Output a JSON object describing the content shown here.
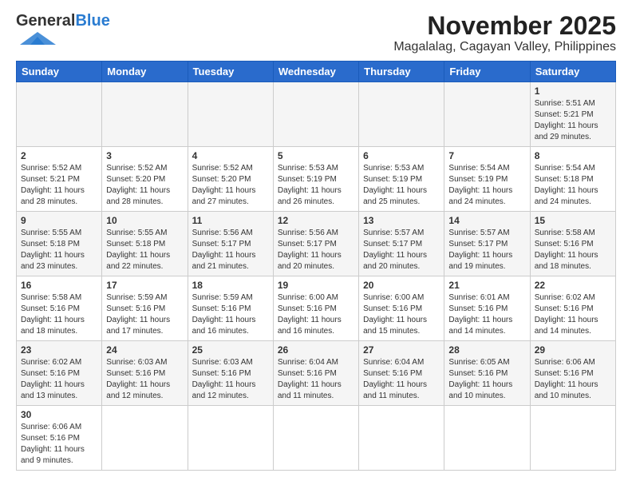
{
  "header": {
    "logo_general": "General",
    "logo_blue": "Blue",
    "month_title": "November 2025",
    "location": "Magalalag, Cagayan Valley, Philippines"
  },
  "days_of_week": [
    "Sunday",
    "Monday",
    "Tuesday",
    "Wednesday",
    "Thursday",
    "Friday",
    "Saturday"
  ],
  "weeks": [
    [
      {
        "day": "",
        "info": ""
      },
      {
        "day": "",
        "info": ""
      },
      {
        "day": "",
        "info": ""
      },
      {
        "day": "",
        "info": ""
      },
      {
        "day": "",
        "info": ""
      },
      {
        "day": "",
        "info": ""
      },
      {
        "day": "1",
        "info": "Sunrise: 5:51 AM\nSunset: 5:21 PM\nDaylight: 11 hours\nand 29 minutes."
      }
    ],
    [
      {
        "day": "2",
        "info": "Sunrise: 5:52 AM\nSunset: 5:21 PM\nDaylight: 11 hours\nand 28 minutes."
      },
      {
        "day": "3",
        "info": "Sunrise: 5:52 AM\nSunset: 5:20 PM\nDaylight: 11 hours\nand 28 minutes."
      },
      {
        "day": "4",
        "info": "Sunrise: 5:52 AM\nSunset: 5:20 PM\nDaylight: 11 hours\nand 27 minutes."
      },
      {
        "day": "5",
        "info": "Sunrise: 5:53 AM\nSunset: 5:19 PM\nDaylight: 11 hours\nand 26 minutes."
      },
      {
        "day": "6",
        "info": "Sunrise: 5:53 AM\nSunset: 5:19 PM\nDaylight: 11 hours\nand 25 minutes."
      },
      {
        "day": "7",
        "info": "Sunrise: 5:54 AM\nSunset: 5:19 PM\nDaylight: 11 hours\nand 24 minutes."
      },
      {
        "day": "8",
        "info": "Sunrise: 5:54 AM\nSunset: 5:18 PM\nDaylight: 11 hours\nand 24 minutes."
      }
    ],
    [
      {
        "day": "9",
        "info": "Sunrise: 5:55 AM\nSunset: 5:18 PM\nDaylight: 11 hours\nand 23 minutes."
      },
      {
        "day": "10",
        "info": "Sunrise: 5:55 AM\nSunset: 5:18 PM\nDaylight: 11 hours\nand 22 minutes."
      },
      {
        "day": "11",
        "info": "Sunrise: 5:56 AM\nSunset: 5:17 PM\nDaylight: 11 hours\nand 21 minutes."
      },
      {
        "day": "12",
        "info": "Sunrise: 5:56 AM\nSunset: 5:17 PM\nDaylight: 11 hours\nand 20 minutes."
      },
      {
        "day": "13",
        "info": "Sunrise: 5:57 AM\nSunset: 5:17 PM\nDaylight: 11 hours\nand 20 minutes."
      },
      {
        "day": "14",
        "info": "Sunrise: 5:57 AM\nSunset: 5:17 PM\nDaylight: 11 hours\nand 19 minutes."
      },
      {
        "day": "15",
        "info": "Sunrise: 5:58 AM\nSunset: 5:16 PM\nDaylight: 11 hours\nand 18 minutes."
      }
    ],
    [
      {
        "day": "16",
        "info": "Sunrise: 5:58 AM\nSunset: 5:16 PM\nDaylight: 11 hours\nand 18 minutes."
      },
      {
        "day": "17",
        "info": "Sunrise: 5:59 AM\nSunset: 5:16 PM\nDaylight: 11 hours\nand 17 minutes."
      },
      {
        "day": "18",
        "info": "Sunrise: 5:59 AM\nSunset: 5:16 PM\nDaylight: 11 hours\nand 16 minutes."
      },
      {
        "day": "19",
        "info": "Sunrise: 6:00 AM\nSunset: 5:16 PM\nDaylight: 11 hours\nand 16 minutes."
      },
      {
        "day": "20",
        "info": "Sunrise: 6:00 AM\nSunset: 5:16 PM\nDaylight: 11 hours\nand 15 minutes."
      },
      {
        "day": "21",
        "info": "Sunrise: 6:01 AM\nSunset: 5:16 PM\nDaylight: 11 hours\nand 14 minutes."
      },
      {
        "day": "22",
        "info": "Sunrise: 6:02 AM\nSunset: 5:16 PM\nDaylight: 11 hours\nand 14 minutes."
      }
    ],
    [
      {
        "day": "23",
        "info": "Sunrise: 6:02 AM\nSunset: 5:16 PM\nDaylight: 11 hours\nand 13 minutes."
      },
      {
        "day": "24",
        "info": "Sunrise: 6:03 AM\nSunset: 5:16 PM\nDaylight: 11 hours\nand 12 minutes."
      },
      {
        "day": "25",
        "info": "Sunrise: 6:03 AM\nSunset: 5:16 PM\nDaylight: 11 hours\nand 12 minutes."
      },
      {
        "day": "26",
        "info": "Sunrise: 6:04 AM\nSunset: 5:16 PM\nDaylight: 11 hours\nand 11 minutes."
      },
      {
        "day": "27",
        "info": "Sunrise: 6:04 AM\nSunset: 5:16 PM\nDaylight: 11 hours\nand 11 minutes."
      },
      {
        "day": "28",
        "info": "Sunrise: 6:05 AM\nSunset: 5:16 PM\nDaylight: 11 hours\nand 10 minutes."
      },
      {
        "day": "29",
        "info": "Sunrise: 6:06 AM\nSunset: 5:16 PM\nDaylight: 11 hours\nand 10 minutes."
      }
    ],
    [
      {
        "day": "30",
        "info": "Sunrise: 6:06 AM\nSunset: 5:16 PM\nDaylight: 11 hours\nand 9 minutes."
      },
      {
        "day": "",
        "info": ""
      },
      {
        "day": "",
        "info": ""
      },
      {
        "day": "",
        "info": ""
      },
      {
        "day": "",
        "info": ""
      },
      {
        "day": "",
        "info": ""
      },
      {
        "day": "",
        "info": ""
      }
    ]
  ]
}
